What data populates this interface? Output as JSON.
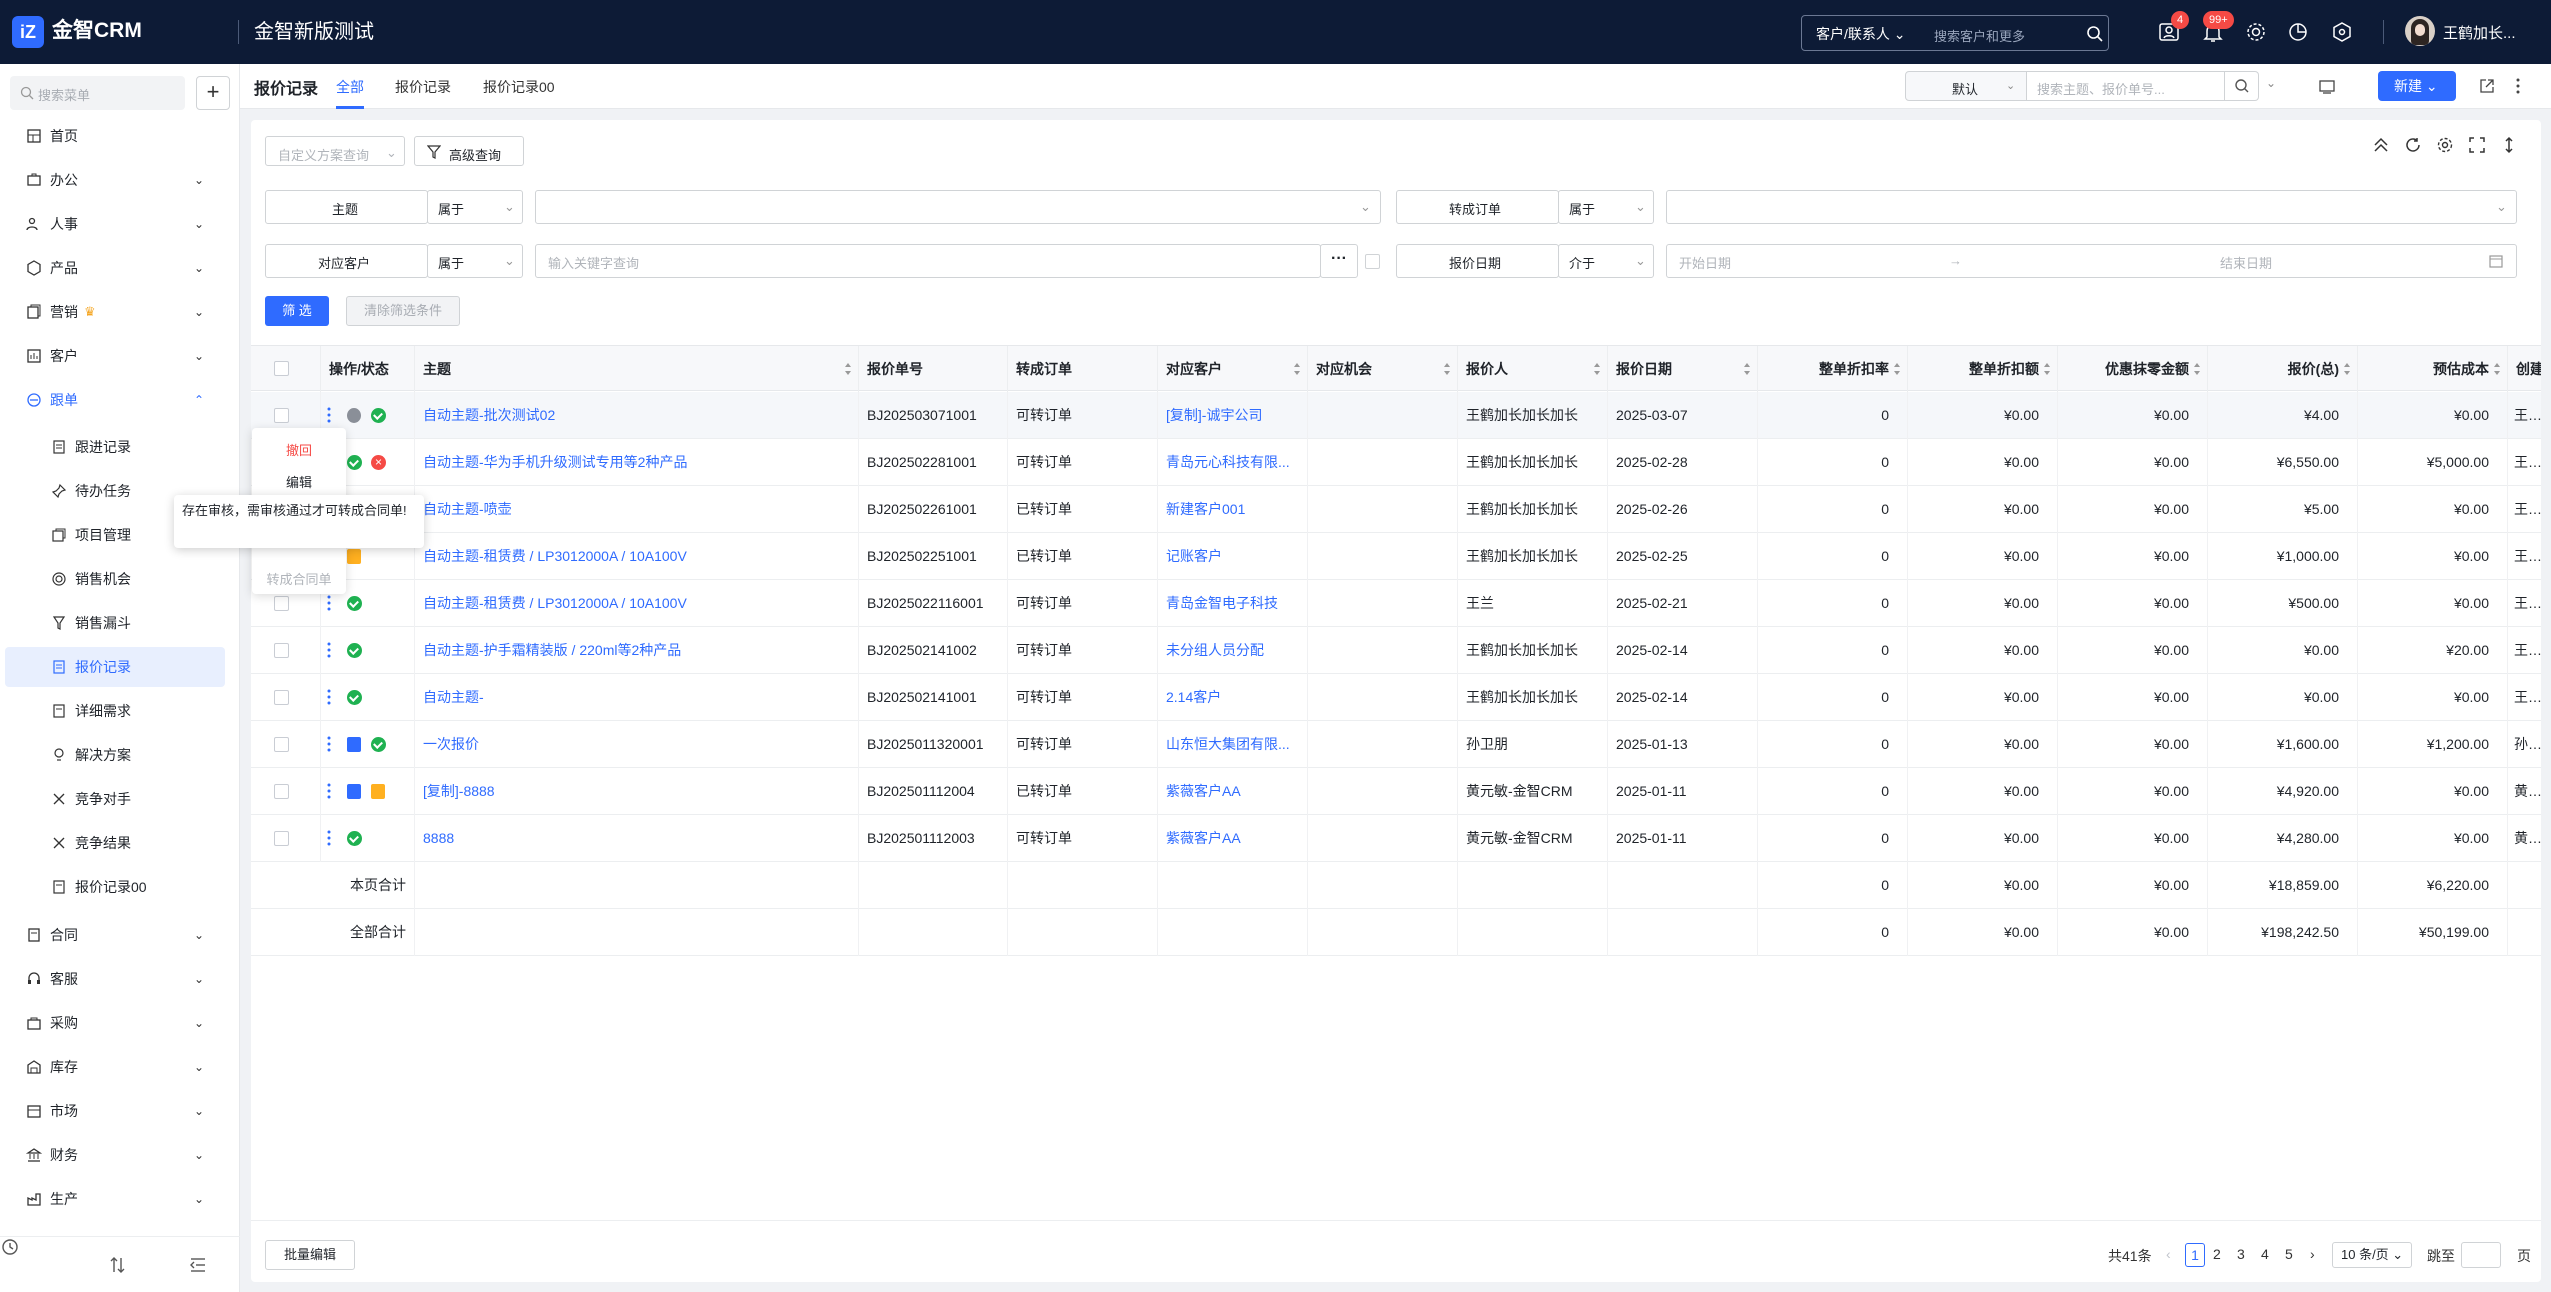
{
  "app": {
    "logo_mark": "iZ",
    "name": "金智CRM",
    "tenant": "金智新版测试"
  },
  "topbar": {
    "search_scope": "客户/联系人",
    "search_placeholder": "搜索客户和更多",
    "notif_badge_1": "4",
    "notif_badge_2": "99+",
    "user_name": "王鹤加长..."
  },
  "sidebar": {
    "search_placeholder": "搜索菜单",
    "items": [
      {
        "label": "首页"
      },
      {
        "label": "办公"
      },
      {
        "label": "人事"
      },
      {
        "label": "产品"
      },
      {
        "label": "营销"
      },
      {
        "label": "客户"
      },
      {
        "label": "跟单"
      },
      {
        "label": "合同"
      },
      {
        "label": "客服"
      },
      {
        "label": "采购"
      },
      {
        "label": "库存"
      },
      {
        "label": "市场"
      },
      {
        "label": "财务"
      },
      {
        "label": "生产"
      }
    ],
    "sub_items": [
      {
        "label": "跟进记录"
      },
      {
        "label": "待办任务"
      },
      {
        "label": "项目管理"
      },
      {
        "label": "销售机会"
      },
      {
        "label": "销售漏斗"
      },
      {
        "label": "报价记录"
      },
      {
        "label": "详细需求"
      },
      {
        "label": "解决方案"
      },
      {
        "label": "竞争对手"
      },
      {
        "label": "竞争结果"
      },
      {
        "label": "报价记录00"
      }
    ]
  },
  "pagehead": {
    "title": "报价记录",
    "tabs": [
      {
        "label": "全部"
      },
      {
        "label": "报价记录"
      },
      {
        "label": "报价记录00"
      }
    ],
    "view_select": "默认",
    "search_placeholder": "搜索主题、报价单号...",
    "new_button": "新建"
  },
  "toolbar": {
    "custom_query_placeholder": "自定义方案查询",
    "advanced_query": "高级查询"
  },
  "filters": {
    "subject_label": "主题",
    "subject_op": "属于",
    "convert_label": "转成订单",
    "convert_op": "属于",
    "customer_label": "对应客户",
    "customer_op": "属于",
    "customer_placeholder": "输入关键字查询",
    "date_label": "报价日期",
    "date_op": "介于",
    "date_start": "开始日期",
    "date_end": "结束日期",
    "filter_button": "筛 选",
    "clear_button": "清除筛选条件"
  },
  "table": {
    "headers": [
      "操作/状态",
      "主题",
      "报价单号",
      "转成订单",
      "对应客户",
      "对应机会",
      "报价人",
      "报价日期",
      "整单折扣率",
      "整单折扣额",
      "优惠抹零金额",
      "报价(总)",
      "预估成本",
      "创建"
    ],
    "rows": [
      {
        "subject": "自动主题-批次测试02",
        "no": "BJ202503071001",
        "convert": "可转订单",
        "customer": "[复制]-诚宇公司",
        "quoter": "王鹤加长加长加长",
        "date": "2025-03-07",
        "rate": "0",
        "disc": "¥0.00",
        "round": "¥0.00",
        "total": "¥4.00",
        "cost": "¥0.00",
        "creator": "王鹤"
      },
      {
        "subject": "自动主题-华为手机升级测试专用等2种产品",
        "no": "BJ202502281001",
        "convert": "可转订单",
        "customer": "青岛元心科技有限...",
        "quoter": "王鹤加长加长加长",
        "date": "2025-02-28",
        "rate": "0",
        "disc": "¥0.00",
        "round": "¥0.00",
        "total": "¥6,550.00",
        "cost": "¥5,000.00",
        "creator": "王鹤"
      },
      {
        "subject": "自动主题-喷壶",
        "no": "BJ202502261001",
        "convert": "已转订单",
        "customer": "新建客户001",
        "quoter": "王鹤加长加长加长",
        "date": "2025-02-26",
        "rate": "0",
        "disc": "¥0.00",
        "round": "¥0.00",
        "total": "¥5.00",
        "cost": "¥0.00",
        "creator": "王鹤"
      },
      {
        "subject": "自动主题-租赁费 / LP3012000A / 10A100V",
        "no": "BJ202502251001",
        "convert": "已转订单",
        "customer": "记账客户",
        "quoter": "王鹤加长加长加长",
        "date": "2025-02-25",
        "rate": "0",
        "disc": "¥0.00",
        "round": "¥0.00",
        "total": "¥1,000.00",
        "cost": "¥0.00",
        "creator": "王鹤"
      },
      {
        "subject": "自动主题-租赁费 / LP3012000A / 10A100V",
        "no": "BJ2025022116001",
        "convert": "可转订单",
        "customer": "青岛金智电子科技",
        "quoter": "王兰",
        "date": "2025-02-21",
        "rate": "0",
        "disc": "¥0.00",
        "round": "¥0.00",
        "total": "¥500.00",
        "cost": "¥0.00",
        "creator": "王兰"
      },
      {
        "subject": "自动主题-护手霜精装版 / 220ml等2种产品",
        "no": "BJ202502141002",
        "convert": "可转订单",
        "customer": "未分组人员分配",
        "quoter": "王鹤加长加长加长",
        "date": "2025-02-14",
        "rate": "0",
        "disc": "¥0.00",
        "round": "¥0.00",
        "total": "¥0.00",
        "cost": "¥20.00",
        "creator": "王鹤"
      },
      {
        "subject": "自动主题-",
        "no": "BJ202502141001",
        "convert": "可转订单",
        "customer": "2.14客户",
        "quoter": "王鹤加长加长加长",
        "date": "2025-02-14",
        "rate": "0",
        "disc": "¥0.00",
        "round": "¥0.00",
        "total": "¥0.00",
        "cost": "¥0.00",
        "creator": "王鹤"
      },
      {
        "subject": "一次报价",
        "no": "BJ2025011320001",
        "convert": "可转订单",
        "customer": "山东恒大集团有限...",
        "quoter": "孙卫朋",
        "date": "2025-01-13",
        "rate": "0",
        "disc": "¥0.00",
        "round": "¥0.00",
        "total": "¥1,600.00",
        "cost": "¥1,200.00",
        "creator": "孙卫"
      },
      {
        "subject": "[复制]-8888",
        "no": "BJ202501112004",
        "convert": "已转订单",
        "customer": "紫薇客户AA",
        "quoter": "黄元敏-金智CRM",
        "date": "2025-01-11",
        "rate": "0",
        "disc": "¥0.00",
        "round": "¥0.00",
        "total": "¥4,920.00",
        "cost": "¥0.00",
        "creator": "黄元"
      },
      {
        "subject": "8888",
        "no": "BJ202501112003",
        "convert": "可转订单",
        "customer": "紫薇客户AA",
        "quoter": "黄元敏-金智CRM",
        "date": "2025-01-11",
        "rate": "0",
        "disc": "¥0.00",
        "round": "¥0.00",
        "total": "¥4,280.00",
        "cost": "¥0.00",
        "creator": "黄元"
      }
    ],
    "page_total": {
      "label": "本页合计",
      "rate": "0",
      "disc": "¥0.00",
      "round": "¥0.00",
      "total": "¥18,859.00",
      "cost": "¥6,220.00"
    },
    "all_total": {
      "label": "全部合计",
      "rate": "0",
      "disc": "¥0.00",
      "round": "¥0.00",
      "total": "¥198,242.50",
      "cost": "¥50,199.00"
    }
  },
  "row_menu": {
    "revoke": "撤回",
    "edit": "编辑",
    "convert_contract": "转成合同单"
  },
  "tooltip": "存在审核，需审核通过才可转成合同单!",
  "footer": {
    "batch_edit": "批量编辑",
    "total": "共41条",
    "pages": [
      "1",
      "2",
      "3",
      "4",
      "5"
    ],
    "prev": "‹",
    "next": "›",
    "page_size": "10 条/页",
    "jump_label": "跳至",
    "page_unit": "页"
  }
}
